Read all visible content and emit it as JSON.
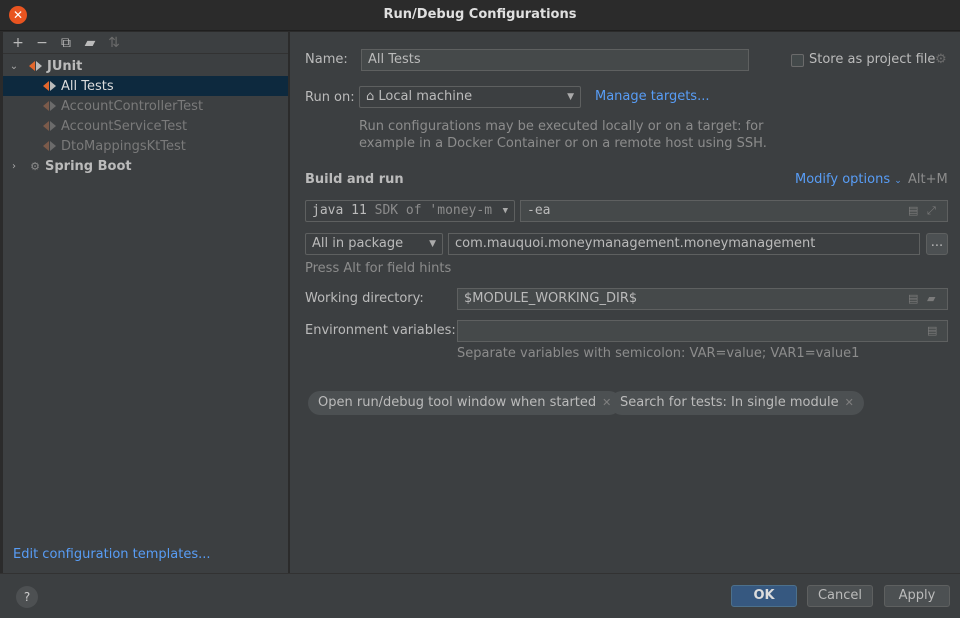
{
  "window": {
    "title": "Run/Debug Configurations",
    "close_icon": "close-icon"
  },
  "sidebar": {
    "toolbar": [
      {
        "name": "add",
        "glyph": "+"
      },
      {
        "name": "remove",
        "glyph": "−"
      },
      {
        "name": "copy",
        "glyph": "⧉"
      },
      {
        "name": "new-folder",
        "glyph": "▰"
      },
      {
        "name": "sort",
        "glyph": "⇅"
      }
    ],
    "tree": {
      "junit_label": "JUnit",
      "items": [
        "All Tests",
        "AccountControllerTest",
        "AccountServiceTest",
        "DtoMappingsKtTest"
      ],
      "selected": "All Tests",
      "spring_label": "Spring Boot"
    },
    "edit_templates": "Edit configuration templates..."
  },
  "form": {
    "name_label": "Name:",
    "name_value": "All Tests",
    "store_label": "Store as project file",
    "store_checked": false,
    "run_on_label": "Run on:",
    "run_on_value": "Local machine",
    "manage_targets": "Manage targets...",
    "run_on_hint_1": "Run configurations may be executed locally or on a target: for",
    "run_on_hint_2": "example in a Docker Container or on a remote host using SSH.",
    "build_run_title": "Build and run",
    "modify_options": "Modify options",
    "modify_shortcut": "Alt+M",
    "jdk_value": "java 11",
    "jdk_detail": "SDK of 'money-m",
    "vm_options": "-ea",
    "test_kind": "All in package",
    "package_value": "com.mauquoi.moneymanagement.moneymanagement",
    "browse_label": "...",
    "field_hints": "Press Alt for field hints",
    "workdir_label": "Working directory:",
    "workdir_value": "$MODULE_WORKING_DIR$",
    "env_label": "Environment variables:",
    "env_value": "",
    "env_hint": "Separate variables with semicolon: VAR=value; VAR1=value1",
    "chips": [
      "Open run/debug tool window when started",
      "Search for tests: In single module"
    ]
  },
  "footer": {
    "help": "?",
    "ok": "OK",
    "cancel": "Cancel",
    "apply": "Apply"
  }
}
